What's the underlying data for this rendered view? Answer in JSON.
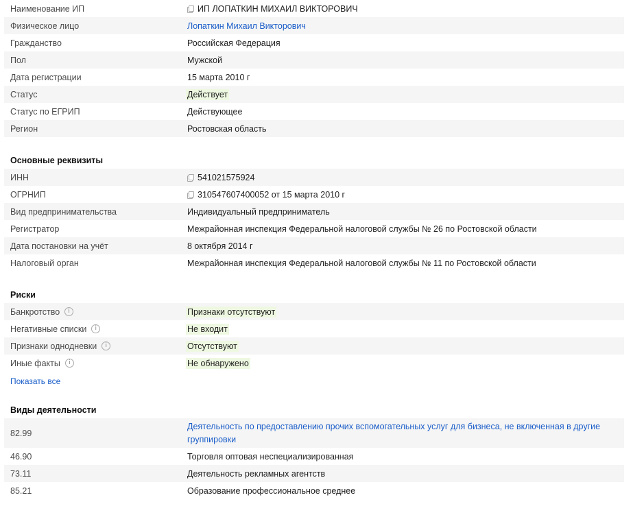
{
  "main_info": [
    {
      "label": "Наименование ИП",
      "value": "ИП ЛОПАТКИН МИХАИЛ ВИКТОРОВИЧ",
      "copy": true
    },
    {
      "label": "Физическое лицо",
      "value": "Лопаткин Михаил Викторович",
      "link": true
    },
    {
      "label": "Гражданство",
      "value": "Российская Федерация"
    },
    {
      "label": "Пол",
      "value": "Мужской"
    },
    {
      "label": "Дата регистрации",
      "value": "15 марта 2010 г"
    },
    {
      "label": "Статус",
      "value": "Действует",
      "highlight": true
    },
    {
      "label": "Статус по ЕГРИП",
      "value": "Действующее"
    },
    {
      "label": "Регион",
      "value": "Ростовская область"
    }
  ],
  "requisites": {
    "title": "Основные реквизиты",
    "rows": [
      {
        "label": "ИНН",
        "value": "541021575924",
        "copy": true
      },
      {
        "label": "ОГРНИП",
        "value": "310547607400052 от 15 марта 2010 г",
        "copy": true
      },
      {
        "label": "Вид предпринимательства",
        "value": "Индивидуальный предприниматель"
      },
      {
        "label": "Регистратор",
        "value": "Межрайонная инспекция Федеральной налоговой службы № 26 по Ростовской области"
      },
      {
        "label": "Дата постановки на учёт",
        "value": "8 октября 2014 г"
      },
      {
        "label": "Налоговый орган",
        "value": "Межрайонная инспекция Федеральной налоговой службы № 11 по Ростовской области"
      }
    ]
  },
  "risks": {
    "title": "Риски",
    "rows": [
      {
        "label": "Банкротство",
        "value": "Признаки отсутствуют"
      },
      {
        "label": "Негативные списки",
        "value": "Не входит"
      },
      {
        "label": "Признаки однодневки",
        "value": "Отсутствуют"
      },
      {
        "label": "Иные факты",
        "value": "Не обнаружено"
      }
    ],
    "show_all": "Показать все",
    "info_glyph": "i"
  },
  "activities": {
    "title": "Виды деятельности",
    "rows": [
      {
        "code": "82.99",
        "value": "Деятельность по предоставлению прочих вспомогательных услуг для бизнеса, не включенная в другие группировки",
        "link": true
      },
      {
        "code": "46.90",
        "value": "Торговля оптовая неспециализированная"
      },
      {
        "code": "73.11",
        "value": "Деятельность рекламных агентств"
      },
      {
        "code": "85.21",
        "value": "Образование профессиональное среднее"
      }
    ]
  },
  "colors": {
    "link": "#1a5dc9",
    "row_shade": "#f5f5f5",
    "status_highlight": "#eef8e1"
  }
}
